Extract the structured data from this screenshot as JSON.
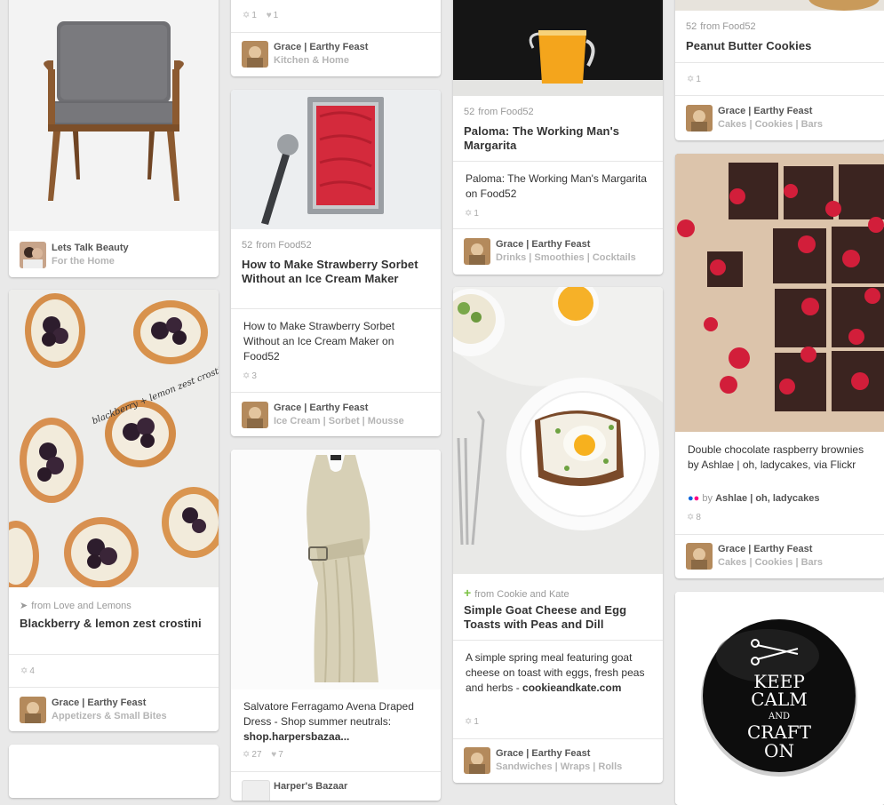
{
  "pins": {
    "chair": {
      "stats": "",
      "board_user": "Lets Talk Beauty",
      "board_name": "For the Home"
    },
    "crostini": {
      "source": "from Love and Lemons",
      "title": "Blackberry & lemon zest crostini",
      "repins": "4",
      "board_user": "Grace | Earthy Feast",
      "board_name": "Appetizers & Small Bites",
      "image_text": "blackberry + lemon zest crostini"
    },
    "kitchen_top": {
      "repins": "1",
      "likes": "1",
      "board_user": "Grace | Earthy Feast",
      "board_name": "Kitchen & Home"
    },
    "sorbet": {
      "source": "from Food52",
      "source_icon": "52",
      "title": "How to Make Strawberry Sorbet Without an Ice Cream Maker",
      "description": "How to Make Strawberry Sorbet Without an Ice Cream Maker on Food52",
      "repins": "3",
      "board_user": "Grace | Earthy Feast",
      "board_name": "Ice Cream | Sorbet | Mousse"
    },
    "dress": {
      "description": "Salvatore Ferragamo Avena Draped Dress - Shop summer neutrals:",
      "link": "shop.harpersbazaa...",
      "repins": "27",
      "likes": "7",
      "board_user": "Harper's Bazaar"
    },
    "paloma": {
      "source": "from Food52",
      "source_icon": "52",
      "title": "Paloma: The Working Man's Margarita",
      "description": "Paloma: The Working Man's Margarita on Food52",
      "repins": "1",
      "board_user": "Grace | Earthy Feast",
      "board_name": "Drinks | Smoothies | Cocktails"
    },
    "goat": {
      "source": "from Cookie and Kate",
      "title": "Simple Goat Cheese and Egg Toasts with Peas and Dill",
      "description": "A simple spring meal featuring goat cheese on toast with eggs, fresh peas and herbs -",
      "link": "cookieandkate.com",
      "repins": "1",
      "board_user": "Grace | Earthy Feast",
      "board_name": "Sandwiches | Wraps | Rolls"
    },
    "cookies": {
      "source": "from Food52",
      "source_icon": "52",
      "title": "Peanut Butter Cookies",
      "repins": "1",
      "board_user": "Grace | Earthy Feast",
      "board_name": "Cakes | Cookies | Bars"
    },
    "brownies": {
      "description": "Double chocolate raspberry brownies by Ashlae | oh, ladycakes, via Flickr",
      "via_prefix": "by",
      "via_name": "Ashlae | oh, ladycakes",
      "repins": "8",
      "board_user": "Grace | Earthy Feast",
      "board_name": "Cakes | Cookies | Bars"
    },
    "keepcalm": {
      "l1": "KEEP",
      "l2": "CALM",
      "l3": "AND",
      "l4": "CRAFT",
      "l5": "ON"
    }
  },
  "icons": {
    "repin": "pushpin-icon",
    "like": "heart-icon",
    "source_food52": "food52-logo",
    "source_cookiekate": "plus-icon",
    "source_loveandlemons": "bird-icon",
    "flickr": "flickr-icon"
  },
  "colors": {
    "page_bg": "#e9e9e9",
    "card_bg": "#ffffff",
    "muted": "#999999",
    "board_name": "#b5b5b5"
  }
}
